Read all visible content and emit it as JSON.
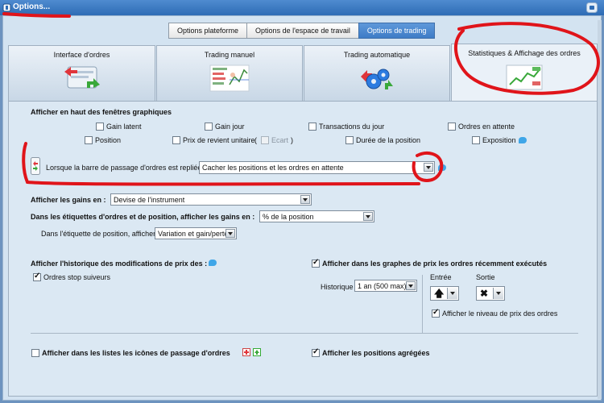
{
  "window": {
    "title": "Options..."
  },
  "top_tabs": [
    "Options plateforme",
    "Options de l'espace de travail",
    "Options de trading"
  ],
  "big_tabs": [
    "Interface d'ordres",
    "Trading manuel",
    "Trading automatique",
    "Statistiques & Affichage des ordres"
  ],
  "section_chart_top": {
    "title": "Afficher en haut des fenêtres graphiques",
    "row1": [
      "Gain latent",
      "Gain jour",
      "Transactions du jour",
      "Ordres en attente"
    ],
    "row2": {
      "position": "Position",
      "prix_revient": "Prix de revient unitaire",
      "paren_open": "(",
      "ecart": "Ecart",
      "paren_close": ")",
      "duree": "Durée de la position",
      "exposition": "Exposition"
    }
  },
  "collapse": {
    "label": "Lorsque la barre de passage d'ordres est repliée :",
    "value": "Cacher les positions et les ordres en attente"
  },
  "gains": {
    "label": "Afficher les gains en :",
    "value": "Devise de l'instrument"
  },
  "labels_gains": {
    "label": "Dans les étiquettes d'ordres et de position, afficher les gains en :",
    "value": "% de la position"
  },
  "position_label": {
    "label": "Dans l'étiquette de position, afficher :",
    "value": "Variation et gain/perte"
  },
  "history": {
    "title": "Afficher l'historique des modifications de prix des :",
    "stop_label": "Ordres stop suiveurs"
  },
  "executed": {
    "title": "Afficher dans les graphes de prix les ordres récemment exécutés",
    "historique_label": "Historique",
    "historique_value": "1 an (500 max)",
    "entree_label": "Entrée",
    "sortie_label": "Sortie",
    "entree_symbol": "🡅",
    "sortie_symbol": "✖",
    "price_level_label": "Afficher le niveau de prix des ordres"
  },
  "bottom": {
    "icons_label": "Afficher dans les listes les icônes de passage d'ordres",
    "aggregated_label": "Afficher les positions agrégées"
  }
}
